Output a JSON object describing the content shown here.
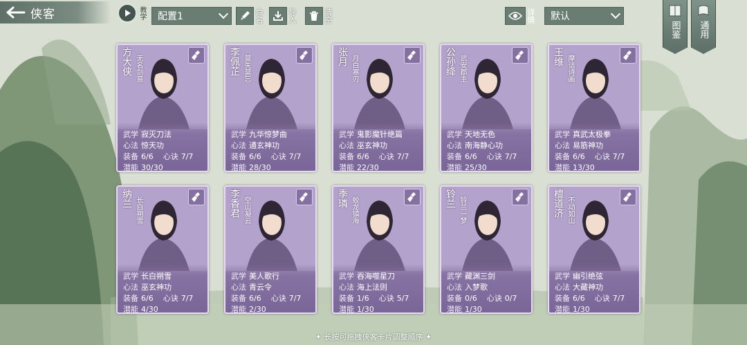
{
  "topbar": {
    "title": "侠客",
    "tutorial_label": "教学",
    "config_value": "配置1",
    "rename_label": "命名",
    "import_label": "导入",
    "clear_label": "清空",
    "detail_label": "详情",
    "sort_value": "默认",
    "catalog_label": "图鉴",
    "general_label": "通用"
  },
  "labels": {
    "wuxue": "武学",
    "xinfa": "心法",
    "zhuangbei": "装备",
    "xinjue": "心诀",
    "qianneng": "潜能"
  },
  "cards": [
    {
      "name": "方大侠",
      "epithet": "无名剑意",
      "wuxue": "寂灭刀法",
      "xinfa": "惊天功",
      "equip": "6/6",
      "jue": "7/7",
      "potential": "30/30"
    },
    {
      "name": "李佩芷",
      "epithet": "莫失莫忘",
      "wuxue": "九华惊梦曲",
      "xinfa": "通玄神功",
      "equip": "6/6",
      "jue": "7/7",
      "potential": "28/30"
    },
    {
      "name": "张月",
      "epithet": "月白寒刃",
      "wuxue": "鬼影魔针绝篇",
      "xinfa": "巫玄神功",
      "equip": "6/6",
      "jue": "7/7",
      "potential": "22/30"
    },
    {
      "name": "公孙绛",
      "epithet": "武安郡主",
      "wuxue": "天地无色",
      "xinfa": "南海静心功",
      "equip": "6/6",
      "jue": "7/7",
      "potential": "25/30"
    },
    {
      "name": "王维",
      "epithet": "摩诘诗画",
      "wuxue": "真武太极拳",
      "xinfa": "易筋神功",
      "equip": "6/6",
      "jue": "7/7",
      "potential": "13/30"
    },
    {
      "name": "纳兰",
      "epithet": "长白朔雪",
      "wuxue": "长白朔雪",
      "xinfa": "巫玄神功",
      "equip": "6/6",
      "jue": "7/7",
      "potential": "4/30"
    },
    {
      "name": "李香君",
      "epithet": "空山凝云",
      "wuxue": "美人歌行",
      "xinfa": "青云令",
      "equip": "6/6",
      "jue": "7/7",
      "potential": "2/30"
    },
    {
      "name": "季璘",
      "epithet": "蛟龙镇海",
      "wuxue": "吞海噬星刀",
      "xinfa": "海上法则",
      "equip": "1/6",
      "jue": "5/7",
      "potential": "1/30"
    },
    {
      "name": "铃兰",
      "epithet": "铃兰一梦",
      "wuxue": "藏渊三剑",
      "xinfa": "入梦歌",
      "equip": "0/6",
      "jue": "0/7",
      "potential": "1/30"
    },
    {
      "name": "檀道济",
      "epithet": "不动如山",
      "wuxue": "幽引绝弦",
      "xinfa": "大藏神功",
      "equip": "6/6",
      "jue": "7/7",
      "potential": "1/30"
    }
  ],
  "hint": "✦ 长按可拖拽侠客卡片调整顺序 ✦",
  "colors": {
    "card_purple": "#a592bd",
    "panel_green": "#6a7d73"
  }
}
